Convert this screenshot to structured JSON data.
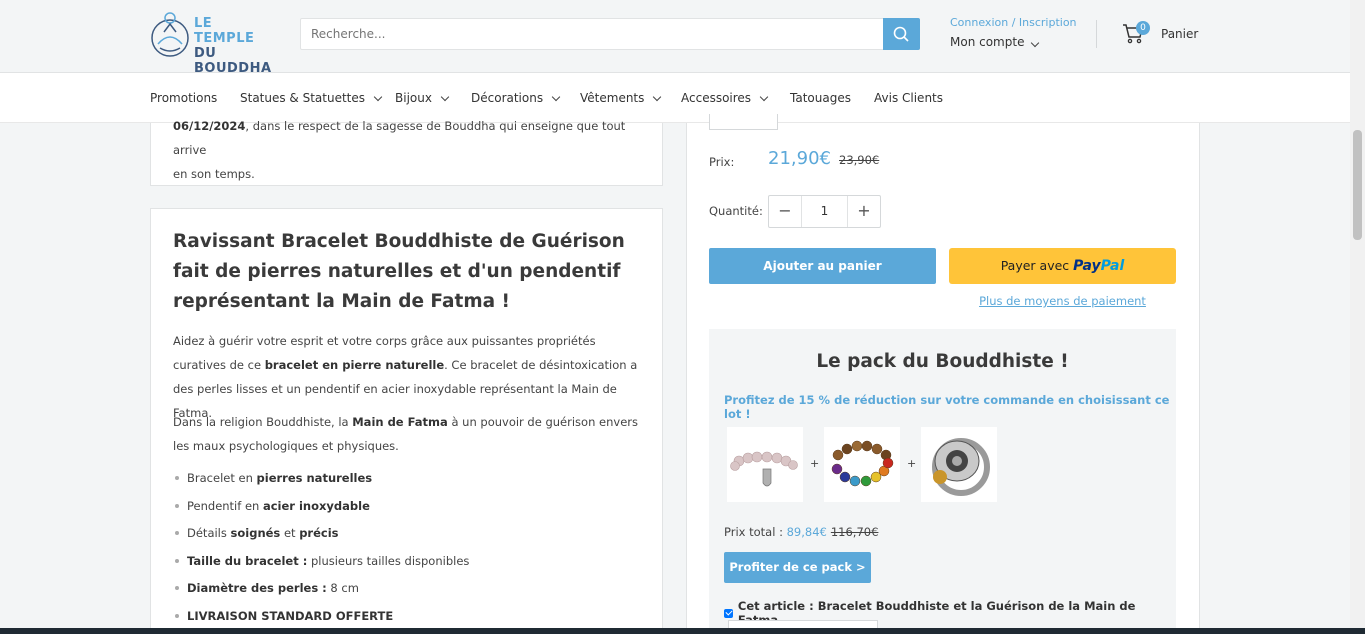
{
  "header": {
    "logo_line1": "LE TEMPLE",
    "logo_line2": "DU BOUDDHA",
    "search_placeholder": "Recherche...",
    "login_link": "Connexion / Inscription",
    "account_label": "Mon compte",
    "cart_count": "0",
    "cart_label": "Panier"
  },
  "nav": {
    "items": [
      {
        "label": "Promotions"
      },
      {
        "label": "Statues & Statuettes"
      },
      {
        "label": "Bijoux"
      },
      {
        "label": "Décorations"
      },
      {
        "label": "Vêtements"
      },
      {
        "label": "Accessoires"
      },
      {
        "label": "Tatouages"
      },
      {
        "label": "Avis Clients"
      }
    ]
  },
  "top_card": {
    "line1_bold": "06/12/2024",
    "line1_rest": ", dans le respect de la sagesse de Bouddha qui enseigne que tout arrive",
    "line2": "en son temps."
  },
  "description": {
    "heading": "Ravissant Bracelet Bouddhiste de Guérison fait de pierres naturelles et d'un pendentif représentant la Main de Fatma !",
    "p1_a": "Aidez à guérir votre esprit et votre corps grâce aux puissantes propriétés curatives de ce ",
    "p1_b": "bracelet en pierre naturelle",
    "p1_c": ". Ce bracelet de désintoxication a des perles lisses et un pendentif en acier inoxydable représentant la Main de Fatma.",
    "p2_a": "Dans la religion Bouddhiste, la ",
    "p2_b": "Main de Fatma",
    "p2_c": " à un pouvoir de guérison envers les maux psychologiques et physiques.",
    "bullets": [
      {
        "a": "Bracelet en ",
        "b": "pierres naturelles",
        "c": ""
      },
      {
        "a": "Pendentif en ",
        "b": "acier inoxydable",
        "c": ""
      },
      {
        "a": "Détails ",
        "b": "soignés",
        "c": " et ",
        "d": "précis"
      },
      {
        "a": "",
        "b": "Taille du bracelet :",
        "c": " plusieurs tailles disponibles"
      },
      {
        "a": "",
        "b": "Diamètre des perles :",
        "c": " 8 cm"
      },
      {
        "a": "",
        "b": "LIVRAISON STANDARD OFFERTE",
        "c": ""
      }
    ]
  },
  "product": {
    "price_label": "Prix:",
    "price_now": "21,90€",
    "price_old": "23,90€",
    "qty_label": "Quantité:",
    "qty_value": "1",
    "qty_minus": "−",
    "qty_plus": "+",
    "add_to_cart": "Ajouter au panier",
    "paypal_prefix": "Payer avec",
    "paypal_brand_1": "Pay",
    "paypal_brand_2": "Pal",
    "more_payment": "Plus de moyens de paiement"
  },
  "pack": {
    "title": "Le pack du Bouddhiste !",
    "subtitle": "Profitez de 15 % de réduction sur votre commande en choisissant ce lot !",
    "plus": "+",
    "total_label": "Prix total : ",
    "total_now": "89,84€",
    "total_old": "116,70€",
    "button": "Profiter de ce pack >",
    "check_label": "Cet article : Bracelet Bouddhiste et la Guérison de la Main de Fatma"
  },
  "colors": {
    "accent": "#5ba8d9",
    "paypal": "#ffc439",
    "page_bg": "#f3f5f6"
  }
}
